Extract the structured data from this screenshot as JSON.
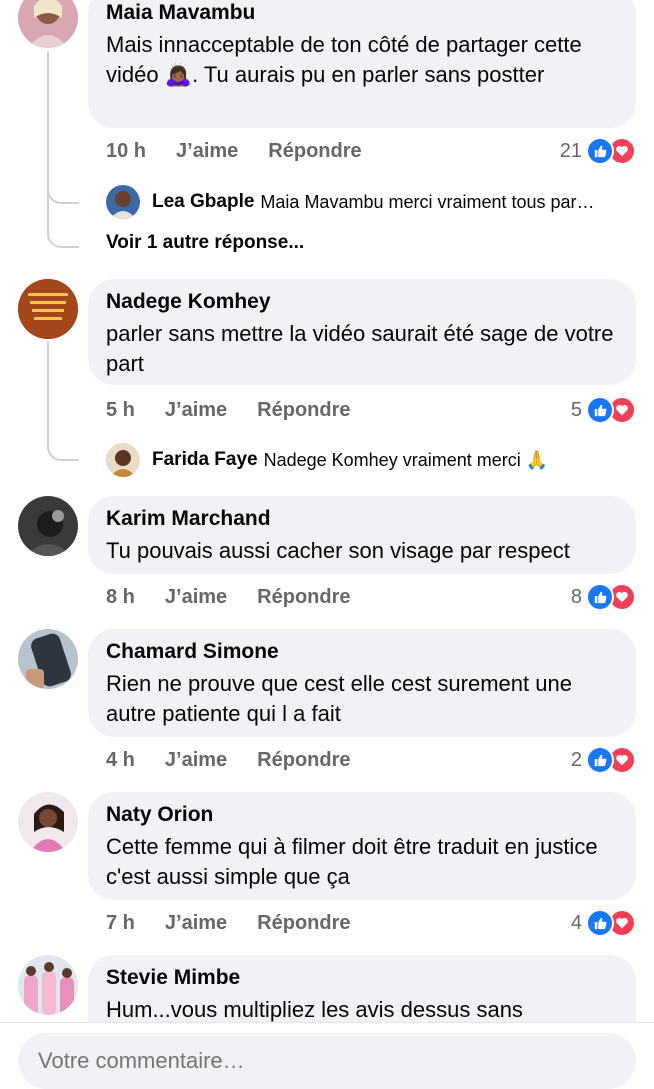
{
  "comments": [
    {
      "author": "Maia Mavambu",
      "text": "Mais innacceptable de ton côté de partager cette vidéo 🙇🏾‍♀️. Tu aurais pu en parler sans postter",
      "time": "10 h",
      "like_label": "J’aime",
      "reply_label": "Répondre",
      "reaction_count": "21",
      "replies": [
        {
          "author": "Lea Gbaple",
          "text": "Maia Mavambu merci vraiment tous par…"
        }
      ],
      "more_replies": "Voir 1 autre réponse..."
    },
    {
      "author": "Nadege Komhey",
      "text": "parler sans mettre la vidéo saurait été sage de votre part",
      "time": "5 h",
      "like_label": "J’aime",
      "reply_label": "Répondre",
      "reaction_count": "5",
      "replies": [
        {
          "author": "Farida Faye",
          "text": "Nadege Komhey vraiment merci 🙏"
        }
      ]
    },
    {
      "author": "Karim Marchand",
      "text": "Tu pouvais aussi cacher son visage par respect",
      "time": "8 h",
      "like_label": "J’aime",
      "reply_label": "Répondre",
      "reaction_count": "8"
    },
    {
      "author": "Chamard Simone",
      "text": "Rien ne prouve que cest elle cest surement une autre patiente  qui l a fait",
      "time": "4 h",
      "like_label": "J’aime",
      "reply_label": "Répondre",
      "reaction_count": "2"
    },
    {
      "author": "Naty Orion",
      "text": "Cette femme qui à filmer doit être traduit en justice c'est aussi simple que ça",
      "time": "7 h",
      "like_label": "J’aime",
      "reply_label": "Répondre",
      "reaction_count": "4"
    },
    {
      "author": "Stevie Mimbe",
      "text": "Hum...vous multipliez les avis dessus sans"
    }
  ],
  "composer": {
    "placeholder": "Votre commentaire…"
  },
  "icons": {
    "like": "like-reaction-icon",
    "love": "love-reaction-icon"
  },
  "colors": {
    "like": "#1877f2",
    "love": "#f33e58",
    "bubble": "#f0f2f5",
    "meta": "#65676b"
  }
}
